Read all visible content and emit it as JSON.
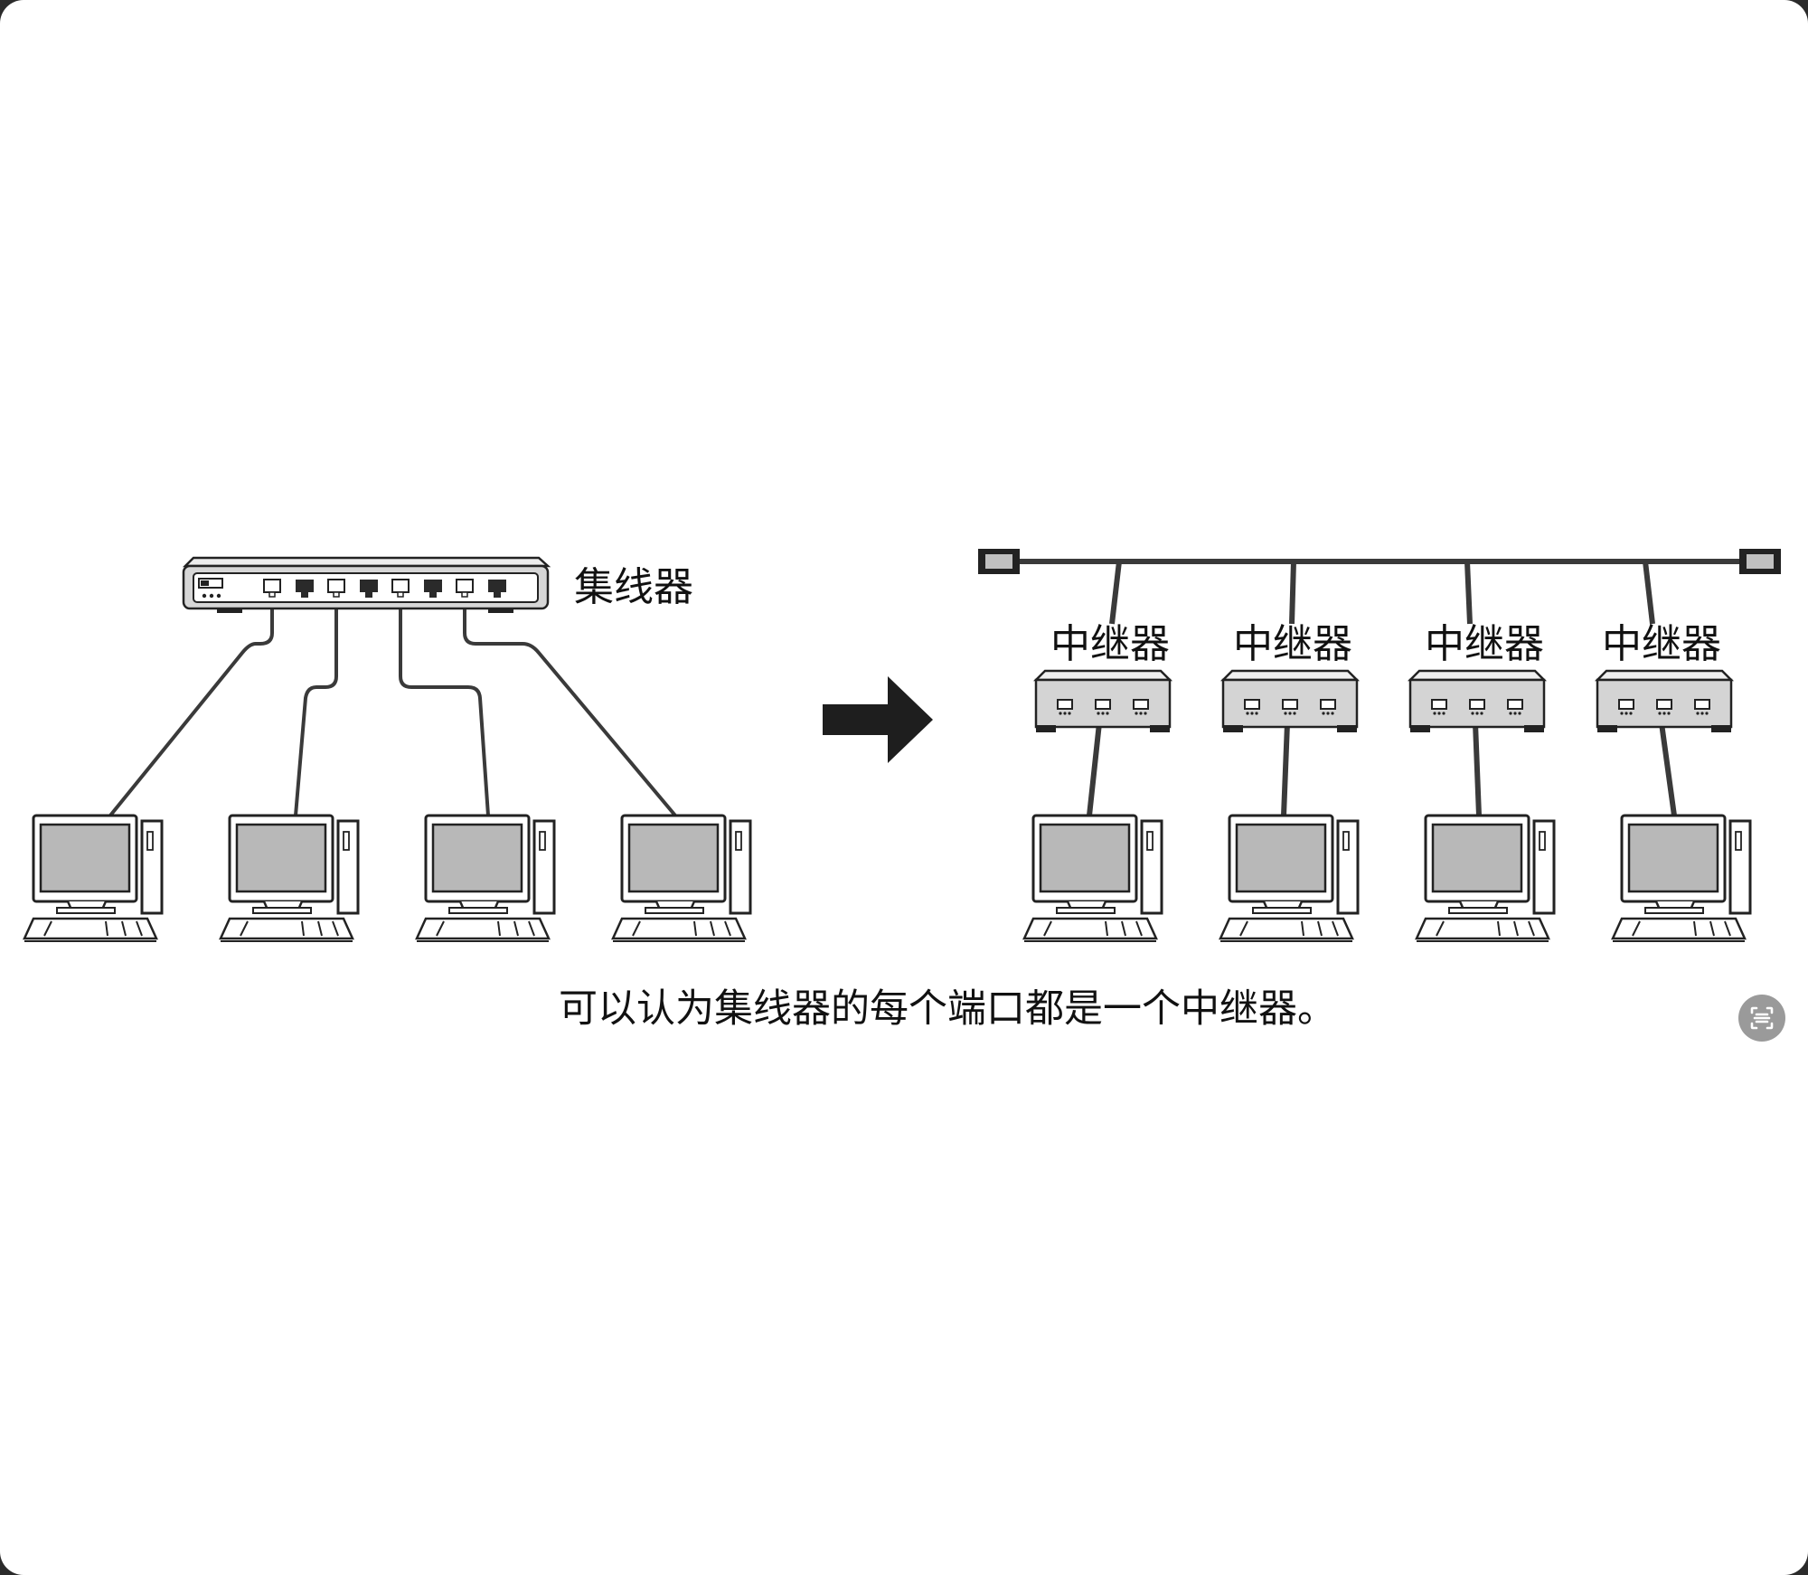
{
  "diagram": {
    "hub_label": "集线器",
    "repeater_label": "中继器",
    "caption": "可以认为集线器的每个端口都是一个中继器。"
  },
  "toolbar": {
    "ocr_button_icon": "text-scan-icon"
  },
  "colors": {
    "outline": "#222222",
    "screen": "#b8b8b8",
    "device_face": "#d4d4d4",
    "bus_line": "#3a3a3a",
    "button": "#9a9a9a"
  }
}
